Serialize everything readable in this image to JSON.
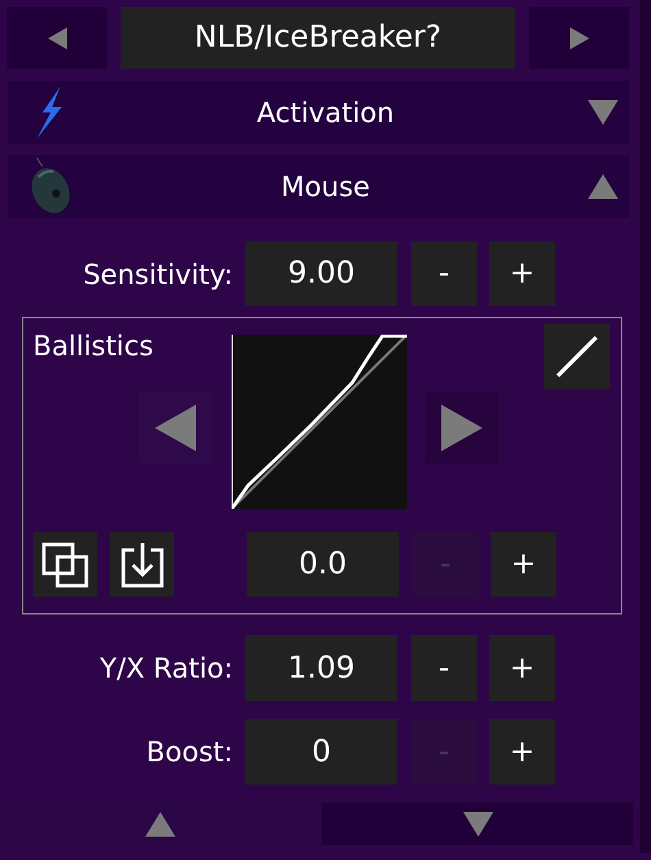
{
  "header": {
    "title": "NLB/IceBreaker?"
  },
  "sections": [
    {
      "label": "Activation",
      "kind": "lightning",
      "expanded": false
    },
    {
      "label": "Mouse",
      "kind": "mouse",
      "expanded": true
    }
  ],
  "sensitivity": {
    "label": "Sensitivity:",
    "value": "9.00",
    "decrement": {
      "label": "-",
      "disabled": false
    },
    "increment": {
      "label": "+",
      "disabled": false
    }
  },
  "ballistics": {
    "title": "Ballistics",
    "value": "0.0",
    "decrement": {
      "label": "-",
      "disabled": true
    },
    "increment": {
      "label": "+",
      "disabled": false
    }
  },
  "settings": [
    {
      "label": "Y/X Ratio:",
      "value": "1.09",
      "decrement": {
        "label": "-",
        "disabled": false
      },
      "increment": {
        "label": "+",
        "disabled": false
      }
    },
    {
      "label": "Boost:",
      "value": "0",
      "decrement": {
        "label": "-",
        "disabled": true
      },
      "increment": {
        "label": "+",
        "disabled": false
      }
    }
  ]
}
